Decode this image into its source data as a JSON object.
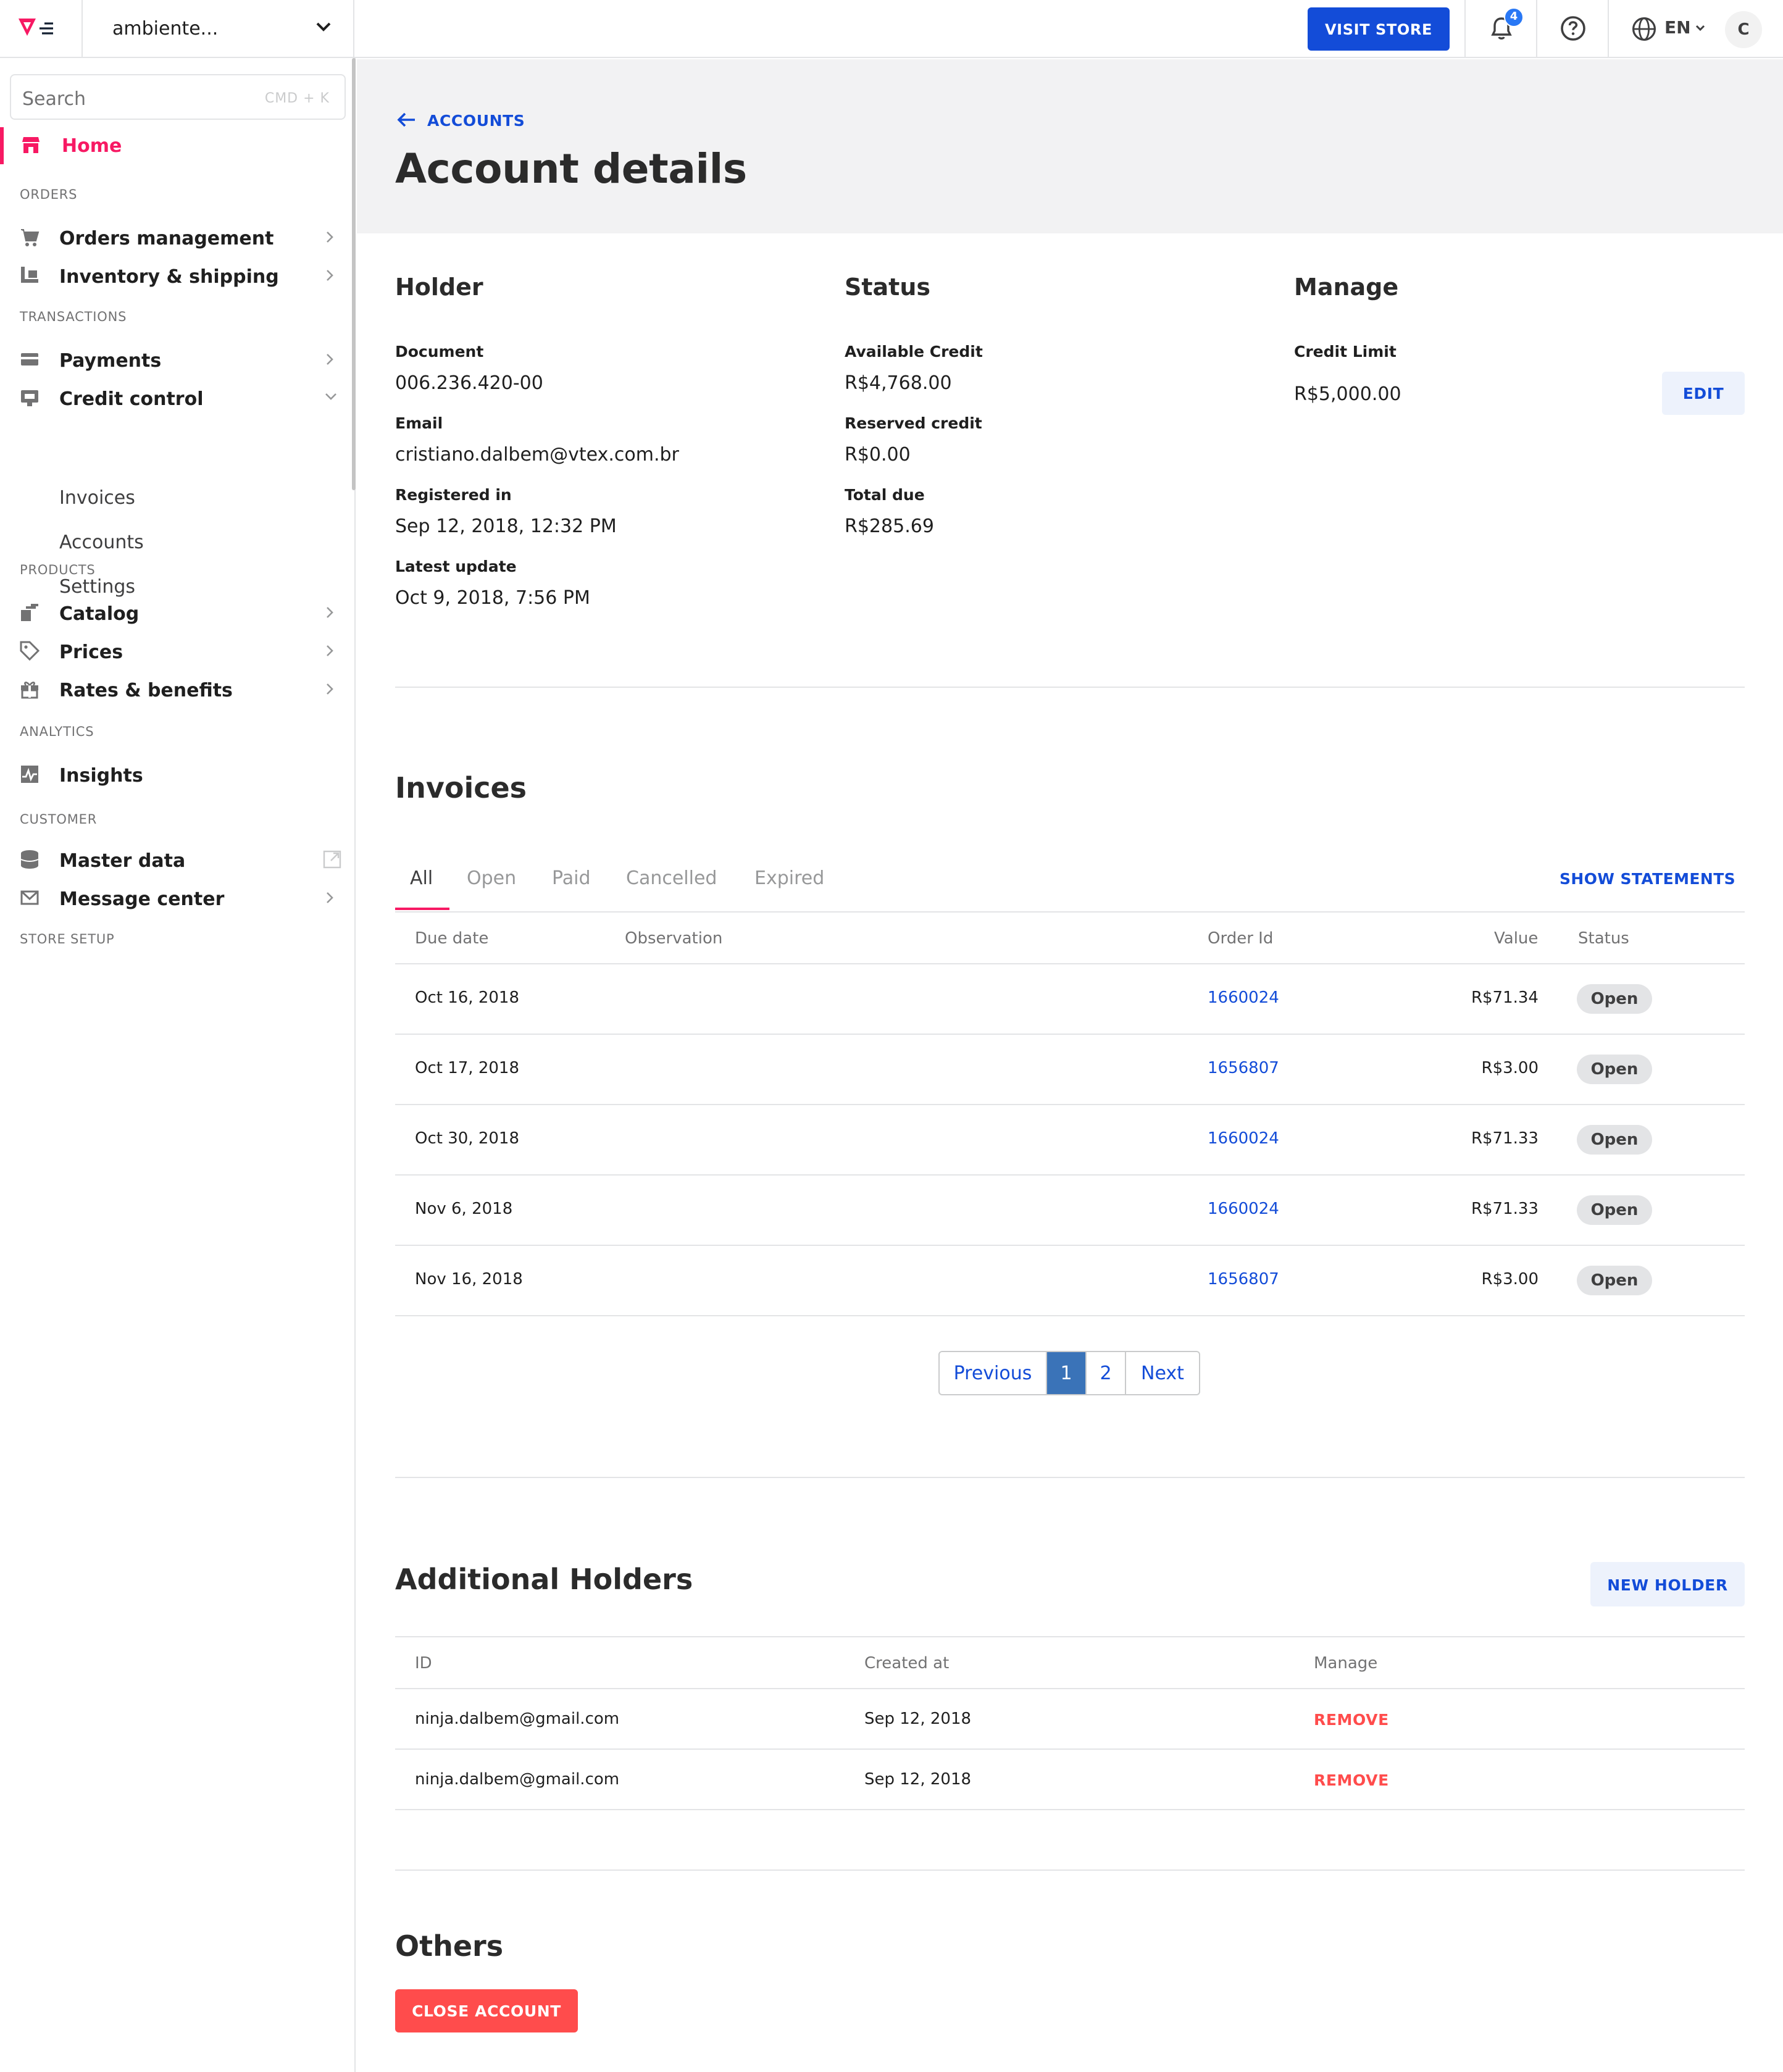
{
  "topbar": {
    "account_name": "ambiente...",
    "visit_store_label": "VISIT STORE",
    "notification_count": "4",
    "language": "EN",
    "avatar_initial": "C"
  },
  "sidebar": {
    "search_placeholder": "Search",
    "search_shortcut": "CMD + K",
    "home_label": "Home",
    "sections": {
      "orders": "ORDERS",
      "transactions": "TRANSACTIONS",
      "products": "PRODUCTS",
      "analytics": "ANALYTICS",
      "customer": "CUSTOMER",
      "store_setup": "STORE SETUP"
    },
    "items": {
      "orders_management": "Orders management",
      "inventory_shipping": "Inventory & shipping",
      "payments": "Payments",
      "credit_control": "Credit control",
      "invoices": "Invoices",
      "accounts": "Accounts",
      "settings": "Settings",
      "catalog": "Catalog",
      "prices": "Prices",
      "rates_benefits": "Rates & benefits",
      "insights": "Insights",
      "master_data": "Master data",
      "message_center": "Message center"
    }
  },
  "header": {
    "back_label": "ACCOUNTS",
    "title": "Account details"
  },
  "holder": {
    "title": "Holder",
    "document_label": "Document",
    "document": "006.236.420-00",
    "email_label": "Email",
    "email": "cristiano.dalbem@vtex.com.br",
    "registered_label": "Registered in",
    "registered": "Sep 12, 2018, 12:32 PM",
    "updated_label": "Latest update",
    "updated": "Oct 9, 2018, 7:56 PM"
  },
  "status": {
    "title": "Status",
    "available_label": "Available Credit",
    "available": "R$4,768.00",
    "reserved_label": "Reserved credit",
    "reserved": "R$0.00",
    "total_due_label": "Total due",
    "total_due": "R$285.69"
  },
  "manage": {
    "title": "Manage",
    "limit_label": "Credit Limit",
    "limit": "R$5,000.00",
    "edit_label": "EDIT"
  },
  "invoices": {
    "title": "Invoices",
    "tabs": [
      "All",
      "Open",
      "Paid",
      "Cancelled",
      "Expired"
    ],
    "show_statements": "SHOW STATEMENTS",
    "columns": {
      "due_date": "Due date",
      "observation": "Observation",
      "order_id": "Order Id",
      "value": "Value",
      "status": "Status"
    },
    "rows": [
      {
        "due_date": "Oct 16, 2018",
        "order_id": "1660024",
        "value": "R$71.34",
        "status": "Open"
      },
      {
        "due_date": "Oct 17, 2018",
        "order_id": "1656807",
        "value": "R$3.00",
        "status": "Open"
      },
      {
        "due_date": "Oct 30, 2018",
        "order_id": "1660024",
        "value": "R$71.33",
        "status": "Open"
      },
      {
        "due_date": "Nov 6, 2018",
        "order_id": "1660024",
        "value": "R$71.33",
        "status": "Open"
      },
      {
        "due_date": "Nov 16, 2018",
        "order_id": "1656807",
        "value": "R$3.00",
        "status": "Open"
      }
    ],
    "pagination": {
      "previous": "Previous",
      "page1": "1",
      "page2": "2",
      "next": "Next"
    }
  },
  "additional_holders": {
    "title": "Additional Holders",
    "new_holder_label": "NEW HOLDER",
    "columns": {
      "id": "ID",
      "created_at": "Created at",
      "manage": "Manage"
    },
    "rows": [
      {
        "id": "ninja.dalbem@gmail.com",
        "created_at": "Sep 12, 2018",
        "action": "REMOVE"
      },
      {
        "id": "ninja.dalbem@gmail.com",
        "created_at": "Sep 12, 2018",
        "action": "REMOVE"
      }
    ]
  },
  "others": {
    "title": "Others",
    "close_account_label": "CLOSE ACCOUNT"
  }
}
